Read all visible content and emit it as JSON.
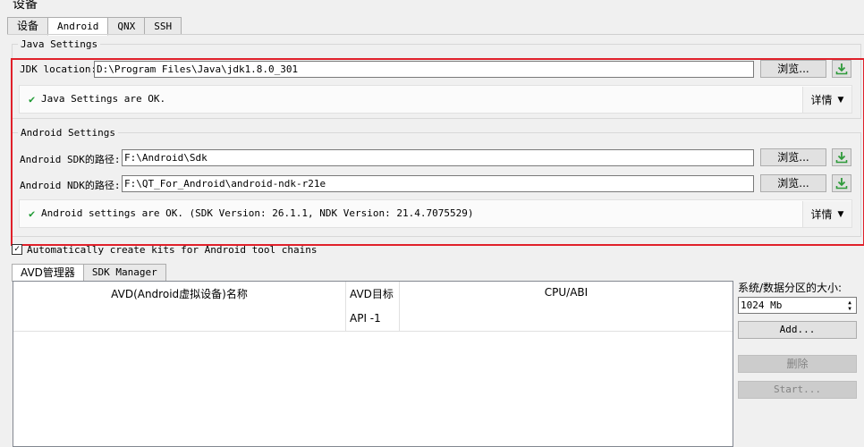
{
  "page_title": "设备",
  "tabs": [
    "设备",
    "Android",
    "QNX",
    "SSH"
  ],
  "active_tab": "Android",
  "java": {
    "group_title": "Java Settings",
    "jdk_label": "JDK location:",
    "jdk_value": "D:\\Program Files\\Java\\jdk1.8.0_301",
    "browse_label": "浏览...",
    "status_text": "Java Settings are OK.",
    "details_label": "详情"
  },
  "android": {
    "group_title": "Android Settings",
    "sdk_label": "Android SDK的路径:",
    "sdk_value": "F:\\Android\\Sdk",
    "ndk_label": "Android NDK的路径:",
    "ndk_value": "F:\\QT_For_Android\\android-ndk-r21e",
    "browse_label": "浏览...",
    "status_text": "Android settings are OK. (SDK Version: 26.1.1, NDK Version: 21.4.7075529)",
    "details_label": "详情"
  },
  "auto_kits": {
    "label": "Automatically create kits for Android tool chains",
    "checked": true
  },
  "bottom_tabs": [
    "AVD管理器",
    "SDK Manager"
  ],
  "avd_table": {
    "headers": [
      "AVD(Android虚拟设备)名称",
      "AVD目标",
      "CPU/ABI"
    ],
    "target_sub": "API -1"
  },
  "side": {
    "partition_label": "系统/数据分区的大小:",
    "partition_value": "1024 Mb",
    "add_label": "Add...",
    "delete_label": "删除",
    "start_label": "Start..."
  },
  "colors": {
    "highlight_border": "#e0202a",
    "check_green": "#1e9a33",
    "download_green": "#2e9a3a"
  }
}
